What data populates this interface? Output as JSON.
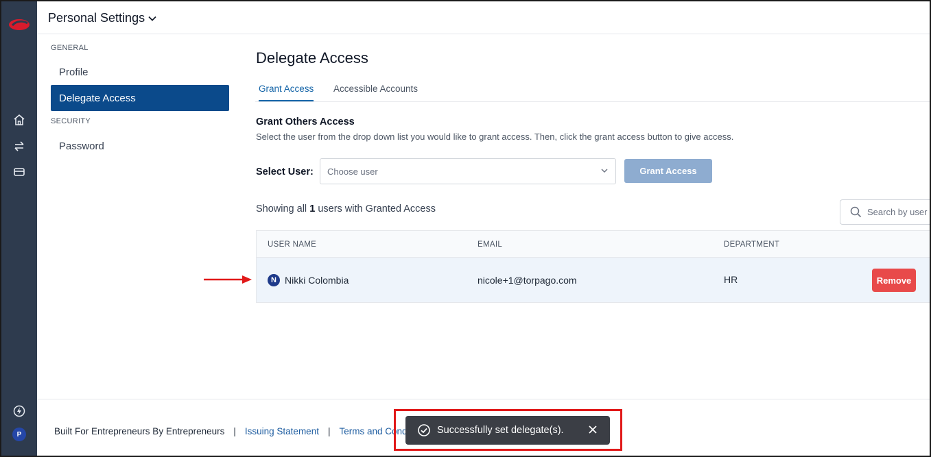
{
  "header": {
    "title": "Personal Settings"
  },
  "sidebar": {
    "sections": [
      {
        "label": "GENERAL"
      },
      {
        "label": "SECURITY"
      }
    ],
    "items": [
      {
        "label": "Profile",
        "active": false
      },
      {
        "label": "Delegate Access",
        "active": true
      },
      {
        "label": "Password",
        "active": false
      }
    ]
  },
  "rail": {
    "icons": [
      "logo-icon",
      "home-icon",
      "transfer-icon",
      "card-icon",
      "bolt-icon"
    ],
    "avatar_initial": "P"
  },
  "main": {
    "title": "Delegate Access",
    "tabs": [
      {
        "label": "Grant Access",
        "active": true
      },
      {
        "label": "Accessible Accounts",
        "active": false
      }
    ],
    "grant_heading": "Grant Others Access",
    "grant_description": "Select the user from the drop down list you would like to grant access. Then, click the grant access button to give access.",
    "select_label": "Select User:",
    "select_placeholder": "Choose user",
    "grant_button": "Grant Access",
    "showing_prefix": "Showing all",
    "showing_count": "1",
    "showing_suffix": "users with Granted Access",
    "search_placeholder": "Search by user name"
  },
  "table": {
    "columns": [
      "USER NAME",
      "EMAIL",
      "DEPARTMENT"
    ],
    "rows": [
      {
        "initial": "N",
        "name": "Nikki Colombia",
        "email": "nicole+1@torpago.com",
        "department": "HR",
        "action": "Remove"
      }
    ]
  },
  "footer": {
    "tagline": "Built For Entrepreneurs By Entrepreneurs",
    "separator": "|",
    "links": [
      "Issuing Statement",
      "Terms and Conditions"
    ]
  },
  "toast": {
    "message": "Successfully set delegate(s)."
  },
  "colors": {
    "rail": "#2e3b4e",
    "active_nav": "#0b4a8b",
    "accent": "#1565a8",
    "grant_button": "#8eacd0",
    "remove_button": "#e84a4a",
    "toast_bg": "#3b3e45",
    "annotation": "#e11919"
  }
}
